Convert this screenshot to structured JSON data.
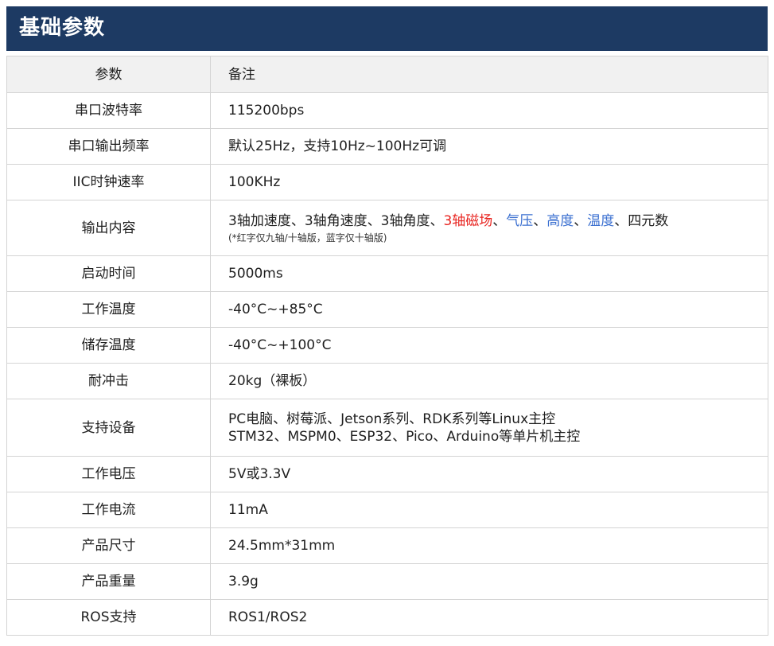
{
  "header": {
    "title": "基础参数"
  },
  "table": {
    "col_param": "参数",
    "col_note": "备注",
    "rows": [
      {
        "name": "串口波特率",
        "value": "115200bps"
      },
      {
        "name": "串口输出频率",
        "value": "默认25Hz，支持10Hz~100Hz可调"
      },
      {
        "name": "IIC时钟速率",
        "value": "100KHz"
      },
      {
        "name": "输出内容",
        "segments": [
          {
            "text": "3轴加速度、3轴角速度、3轴角度、",
            "color": "default"
          },
          {
            "text": "3轴磁场",
            "color": "#e8231f"
          },
          {
            "text": "、",
            "color": "default"
          },
          {
            "text": "气压",
            "color": "#3a6fd0"
          },
          {
            "text": "、",
            "color": "default"
          },
          {
            "text": "高度",
            "color": "#3a6fd0"
          },
          {
            "text": "、",
            "color": "default"
          },
          {
            "text": "温度",
            "color": "#3a6fd0"
          },
          {
            "text": "、四元数",
            "color": "default"
          }
        ],
        "note": "(*红字仅九轴/十轴版，蓝字仅十轴版)"
      },
      {
        "name": "启动时间",
        "value": "5000ms"
      },
      {
        "name": "工作温度",
        "value": "-40°C~+85°C"
      },
      {
        "name": "储存温度",
        "value": "-40°C~+100°C"
      },
      {
        "name": "耐冲击",
        "value": "20kg（裸板）"
      },
      {
        "name": "支持设备",
        "line1": "PC电脑、树莓派、Jetson系列、RDK系列等Linux主控",
        "line2": "STM32、MSPM0、ESP32、Pico、Arduino等单片机主控"
      },
      {
        "name": "工作电压",
        "value": "5V或3.3V"
      },
      {
        "name": "工作电流",
        "value": "11mA"
      },
      {
        "name": "产品尺寸",
        "value": "24.5mm*31mm"
      },
      {
        "name": "产品重量",
        "value": "3.9g"
      },
      {
        "name": "ROS支持",
        "value": "ROS1/ROS2"
      }
    ]
  },
  "colors": {
    "header_bg": "#1d3a63",
    "header_text": "#ffffff",
    "table_head_bg": "#f1f1f1",
    "border": "#d4d4d4",
    "red_highlight": "#e8231f",
    "blue_highlight": "#3a6fd0"
  }
}
